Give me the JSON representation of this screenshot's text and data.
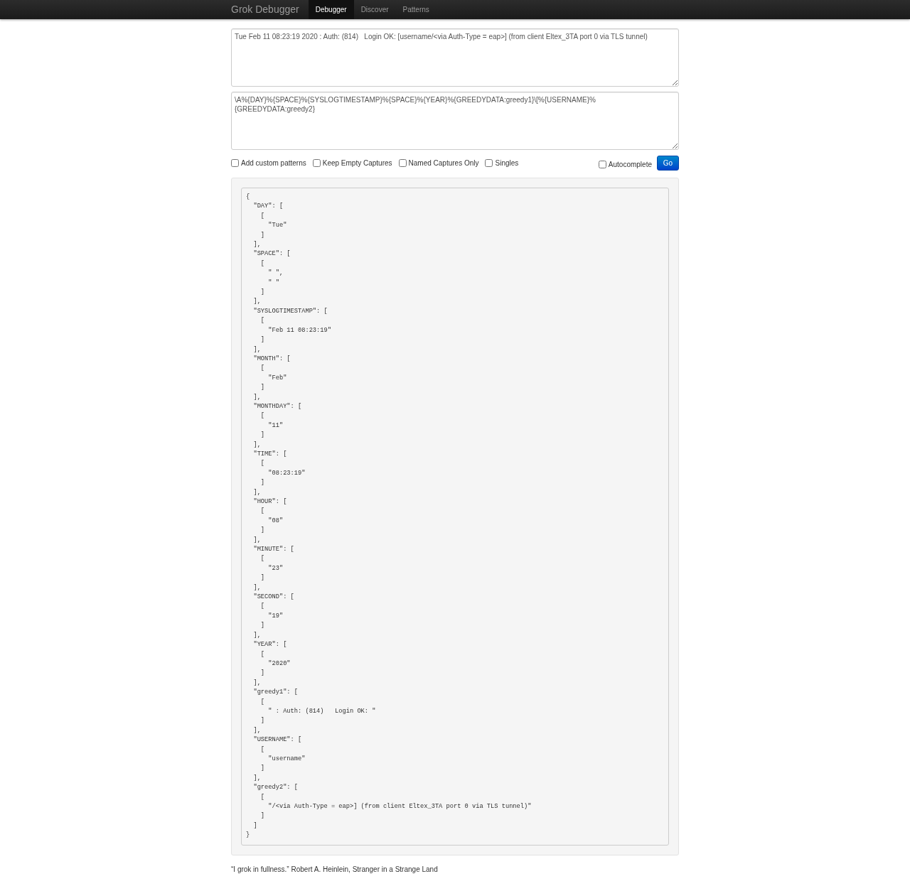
{
  "navbar": {
    "brand": "Grok Debugger",
    "tabs": [
      {
        "label": "Debugger",
        "selected": true
      },
      {
        "label": "Discover",
        "selected": false
      },
      {
        "label": "Patterns",
        "selected": false
      }
    ]
  },
  "input": {
    "value": "Tue Feb 11 08:23:19 2020 : Auth: (814)   Login OK: [username/<via Auth-Type = eap>] (from client Eltex_3TA port 0 via TLS tunnel)"
  },
  "pattern": {
    "value": "\\A%{DAY}%{SPACE}%{SYSLOGTIMESTAMP}%{SPACE}%{YEAR}%{GREEDYDATA:greedy1}\\[%{USERNAME}%{GREEDYDATA:greedy2}"
  },
  "options": [
    {
      "label": "Add custom patterns",
      "checked": false
    },
    {
      "label": "Keep Empty Captures",
      "checked": false
    },
    {
      "label": "Named Captures Only",
      "checked": false
    },
    {
      "label": "Singles",
      "checked": false
    }
  ],
  "autocomplete": {
    "label": "Autocomplete",
    "checked": false
  },
  "go_button": "Go",
  "output": "{\n  \"DAY\": [\n    [\n      \"Tue\"\n    ]\n  ],\n  \"SPACE\": [\n    [\n      \" \",\n      \" \"\n    ]\n  ],\n  \"SYSLOGTIMESTAMP\": [\n    [\n      \"Feb 11 08:23:19\"\n    ]\n  ],\n  \"MONTH\": [\n    [\n      \"Feb\"\n    ]\n  ],\n  \"MONTHDAY\": [\n    [\n      \"11\"\n    ]\n  ],\n  \"TIME\": [\n    [\n      \"08:23:19\"\n    ]\n  ],\n  \"HOUR\": [\n    [\n      \"08\"\n    ]\n  ],\n  \"MINUTE\": [\n    [\n      \"23\"\n    ]\n  ],\n  \"SECOND\": [\n    [\n      \"19\"\n    ]\n  ],\n  \"YEAR\": [\n    [\n      \"2020\"\n    ]\n  ],\n  \"greedy1\": [\n    [\n      \" : Auth: (814)   Login OK: \"\n    ]\n  ],\n  \"USERNAME\": [\n    [\n      \"username\"\n    ]\n  ],\n  \"greedy2\": [\n    [\n      \"/<via Auth-Type = eap>] (from client Eltex_3TA port 0 via TLS tunnel)\"\n    ]\n  ]\n}",
  "footer": "“I grok in fullness.” Robert A. Heinlein, Stranger in a Strange Land"
}
